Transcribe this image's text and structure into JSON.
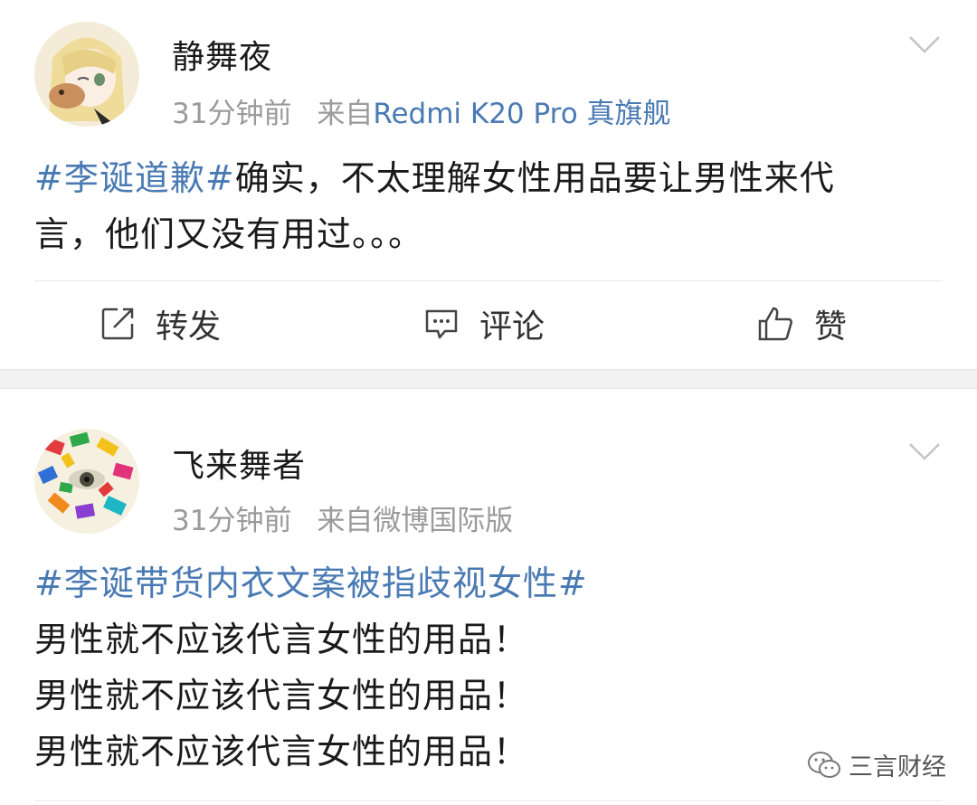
{
  "posts": [
    {
      "username": "静舞夜",
      "time": "31分钟前",
      "source_prefix": "来自",
      "source": "Redmi K20 Pro 真旗舰",
      "hashtag": "#李诞道歉#",
      "text_line1_rest": "确实，不太理解女性用品要让男性来代",
      "text_line2": "言，他们又没有用过。。。",
      "actions": {
        "repost": "转发",
        "comment": "评论",
        "like": "赞"
      }
    },
    {
      "username": "飞来舞者",
      "time": "31分钟前",
      "source_prefix": "来自",
      "source": "微博国际版",
      "hashtag": "#李诞带货内衣文案被指歧视女性#",
      "lines": [
        "男性就不应该代言女性的用品！",
        "男性就不应该代言女性的用品！",
        "男性就不应该代言女性的用品！"
      ]
    }
  ],
  "watermark": {
    "text": "三言财经"
  },
  "colors": {
    "link": "#4a7ab3",
    "meta": "#9a9a9a",
    "separator": "#f2f2f2"
  },
  "icons": [
    "chevron-down-icon",
    "repost-icon",
    "comment-icon",
    "like-icon",
    "wechat-icon"
  ]
}
